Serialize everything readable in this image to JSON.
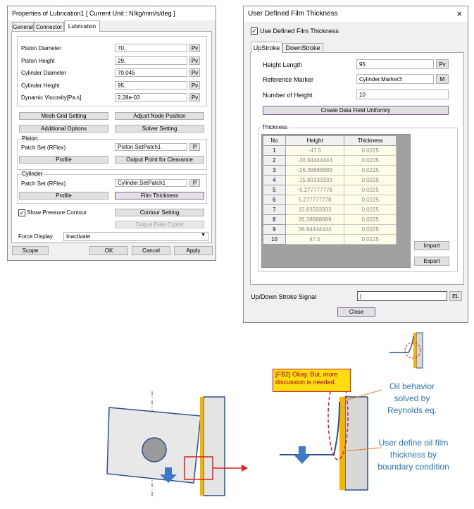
{
  "props": {
    "title": "Properties of Lubrication1 [ Current Unit : N/kg/mm/s/deg ]",
    "tabs": [
      "General",
      "Connector",
      "Lubrication"
    ],
    "fields": [
      {
        "label": "Piston Diameter",
        "value": "70.",
        "btn": "Pv"
      },
      {
        "label": "Piston Height",
        "value": "29.",
        "btn": "Pv"
      },
      {
        "label": "Cylinder Diameter",
        "value": "70.045",
        "btn": "Pv"
      },
      {
        "label": "Cylinder Height",
        "value": "95.",
        "btn": "Pv"
      },
      {
        "label": "Dynamic Viscosity[Pa.s]",
        "value": "2.28e-03",
        "btn": "Pv"
      }
    ],
    "buttons": {
      "mesh": "Mesh Grid Setting",
      "adjust": "Adjust Node Position",
      "additional": "Additional Options",
      "solver": "Solver Setting"
    },
    "piston": {
      "legend": "Piston",
      "patch_label": "Patch Set (RFlex)",
      "patch_value": "Piston.SetPatch1",
      "patch_btn": "P",
      "profile": "Profile",
      "output": "Output Point for Clearance"
    },
    "cylinder": {
      "legend": "Cylinder",
      "patch_label": "Patch Set (RFlex)",
      "patch_value": "Cylinder.SetPatch1",
      "patch_btn": "P",
      "profile": "Profile",
      "film": "Film Thickness"
    },
    "show_pressure": "Show Pressure Contour",
    "contour": "Contour Setting",
    "export": "Output Data Export",
    "force_label": "Force Display",
    "force_value": "Inactivate",
    "footer": {
      "scope": "Scope",
      "ok": "OK",
      "cancel": "Cancel",
      "apply": "Apply"
    }
  },
  "film": {
    "title": "User Defined Film Thickness",
    "close": "×",
    "use_label": "Use Defined Film Thickness",
    "tabs": [
      "UpStroke",
      "DownStroke"
    ],
    "rows": [
      {
        "label": "Height Length",
        "value": "95",
        "btn": "Pv"
      },
      {
        "label": "Reference Marker",
        "value": "Cylinder.Marker3",
        "btn": "M"
      },
      {
        "label": "Number of Height",
        "value": "10"
      }
    ],
    "create": "Create Data Field Uniformly",
    "thickness_legend": "Thickness",
    "table": {
      "headers": [
        "No",
        "Height",
        "Thickness"
      ],
      "rows": [
        [
          "1",
          "-47.5",
          "0.0225"
        ],
        [
          "2",
          "-36.94444444",
          "0.0225"
        ],
        [
          "3",
          "-26.38888889",
          "0.0225"
        ],
        [
          "4",
          "-15.83333333",
          "0.0225"
        ],
        [
          "5",
          "-5.277777778",
          "0.0225"
        ],
        [
          "6",
          "5.277777778",
          "0.0225"
        ],
        [
          "7",
          "15.83333333",
          "0.0225"
        ],
        [
          "8",
          "26.38888889",
          "0.0225"
        ],
        [
          "9",
          "36.94444444",
          "0.0225"
        ],
        [
          "10",
          "47.5",
          "0.0225"
        ]
      ]
    },
    "import": "Import",
    "export": "Export",
    "signal_label": "Up/Down Stroke Signal",
    "signal_value": "",
    "signal_btn": "EL",
    "close_btn": "Close"
  },
  "diagram": {
    "callout": "[FB2] Okay. But, more discussion is needed.",
    "oil_note": "Oil behavior solved by Reynolds eq.",
    "film_note": "User define oil film thickness by boundary condition"
  }
}
